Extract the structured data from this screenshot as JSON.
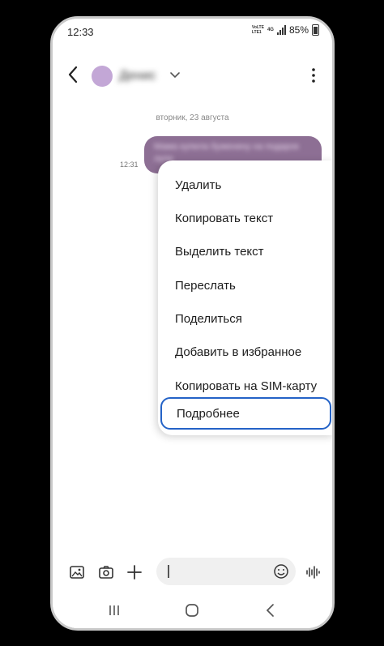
{
  "status_bar": {
    "time": "12:33",
    "network_top": "VoLTE",
    "network_mid": "LTE1",
    "network_type": "4G",
    "battery": "85%"
  },
  "header": {
    "contact_name": "Денис",
    "avatar_color": "#c3a7d6"
  },
  "conversation": {
    "date": "вторник, 23 августа",
    "message_time": "12:31",
    "message_text": "Мама купила буженину на подарок лупе",
    "bubble_color": "#8d6f94"
  },
  "context_menu": {
    "items": [
      {
        "label": "Удалить"
      },
      {
        "label": "Копировать текст"
      },
      {
        "label": "Выделить текст"
      },
      {
        "label": "Переслать"
      },
      {
        "label": "Поделиться"
      },
      {
        "label": "Добавить в избранное"
      },
      {
        "label": "Копировать на SIM-карту"
      },
      {
        "label": "Подробнее"
      }
    ],
    "highlight_color": "#2463c7"
  },
  "input_bar": {
    "icons": [
      "gallery-icon",
      "camera-icon",
      "plus-icon",
      "emoji-icon",
      "voice-icon"
    ]
  },
  "nav_bar": {
    "icons": [
      "recent-apps-icon",
      "home-icon",
      "back-icon"
    ]
  }
}
